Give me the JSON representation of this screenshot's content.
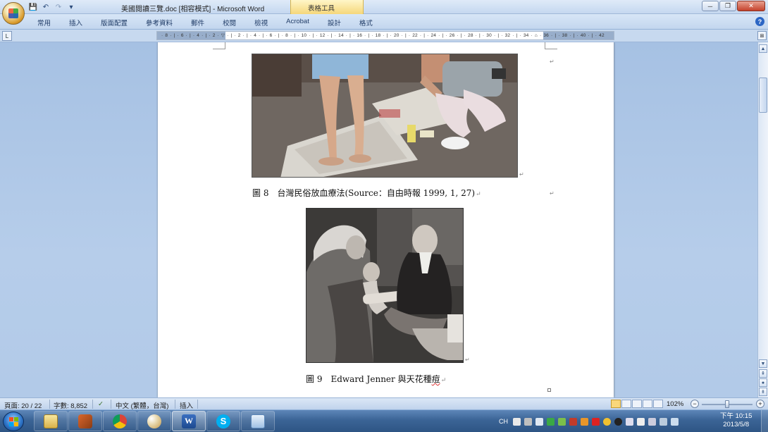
{
  "window": {
    "doc_title": "美國閱讀三覽.doc [相容模式] - Microsoft Word",
    "contextual_tab_group": "表格工具",
    "controls": {
      "minimize": "─",
      "restore": "❐",
      "close": "✕"
    }
  },
  "quick_access": {
    "save_icon": "💾",
    "undo_icon": "↶",
    "redo_icon": "↷",
    "customize_icon": "▾"
  },
  "ribbon": {
    "tabs": [
      "常用",
      "插入",
      "版面配置",
      "參考資料",
      "郵件",
      "校閱",
      "檢視",
      "Acrobat",
      "設計",
      "格式"
    ],
    "help_icon": "?"
  },
  "ruler": {
    "tab_selector": "L",
    "ticks": "· 8 · | · 6 · | · 4 · | · 2 · ▽ · | · 2 · | · 4 · | · 6 · | · 8 · | · 10 · | · 12 · | · 14 · | · 16 · | · 18 · | · 20 · | · 22 · | · 24 · | · 26 · | · 28 · | · 30 · | · 32 · | · 34 · ⌂ · 36 · | · 38 · | · 40 · | · 42",
    "view_ruler_icon": "⊞"
  },
  "document": {
    "caption1_prefix": "圖 8　台灣民俗放血療法(Source：自由時報 1999, 1, 27)",
    "caption2_prefix": "圖 9　Edward Jenner  與天花種",
    "caption2_wavy": "痘",
    "pilcrow": "↵"
  },
  "scrollbar": {
    "up": "▲",
    "down": "▼",
    "prev_page": "⇞",
    "select_browse": "●",
    "next_page": "⇟"
  },
  "statusbar": {
    "page": "頁面: 20 / 22",
    "words": "字數: 8,852",
    "spell_icon": "✓",
    "language": "中文 (繁體，台灣)",
    "mode": "插入",
    "zoom": "102%",
    "zoom_out": "−",
    "zoom_in": "+"
  },
  "taskbar": {
    "apps": [
      {
        "name": "explorer",
        "active": false
      },
      {
        "name": "program",
        "active": false
      },
      {
        "name": "chrome",
        "active": false
      },
      {
        "name": "paint",
        "active": false
      },
      {
        "name": "word",
        "active": true
      },
      {
        "name": "skype",
        "active": false
      },
      {
        "name": "notepad",
        "active": false
      }
    ],
    "lang": "CH",
    "time": "下午 10:15",
    "date": "2013/5/8"
  },
  "colors": {
    "accent": "#2b5797",
    "page": "#ffffff",
    "workspace": "#a9c4e4"
  }
}
